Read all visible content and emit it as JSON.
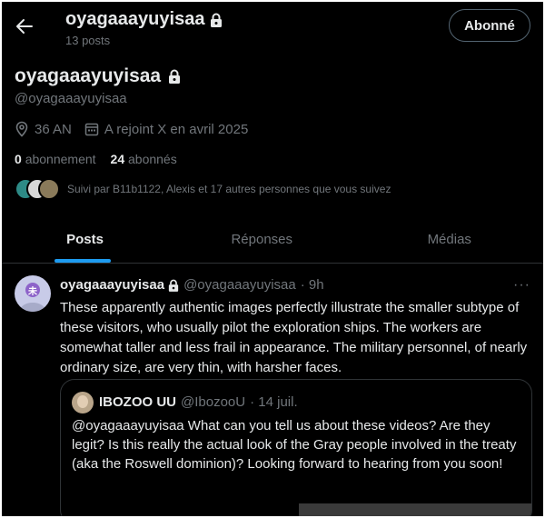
{
  "header": {
    "name": "oyagaaayuyisaa",
    "post_count": "13 posts",
    "follow_label": "Abonné"
  },
  "profile": {
    "name": "oyagaaayuyisaa",
    "handle": "@oyagaaayuyisaa",
    "location": "36 AN",
    "joined": "A rejoint X en avril 2025",
    "following_count": "0",
    "following_label": "abonnement",
    "followers_count": "24",
    "followers_label": "abonnés",
    "followed_by": "Suivi par B11b1122, Alexis et 17 autres personnes que vous suivez"
  },
  "tabs": [
    {
      "label": "Posts",
      "active": true
    },
    {
      "label": "Réponses",
      "active": false
    },
    {
      "label": "Médias",
      "active": false
    }
  ],
  "tweet": {
    "name": "oyagaaayuyisaa",
    "handle": "@oyagaaayuyisaa",
    "date": "· 9h",
    "more": "···",
    "avatar_glyph": "未",
    "text": "These apparently authentic images perfectly illustrate the smaller subtype of these visitors, who usually pilot the exploration ships. The workers are somewhat taller and less frail in appearance. The military personnel, of nearly ordinary size, are very thin, with harsher faces.",
    "quote": {
      "name": "IBOZOO UU",
      "handle": "@IbozooU",
      "date": "· 14 juil.",
      "text": "@oyagaaayuyisaa What can you tell us about these videos? Are they legit? Is this really the actual look of the Gray people involved in the treaty (aka the Roswell dominion)? Looking forward to hearing from you soon!"
    }
  },
  "colors": {
    "background": "#000000",
    "text": "#e7e9ea",
    "muted": "#71767b",
    "accent": "#1d9bf0",
    "border": "#2f3336"
  },
  "icons": [
    "back-arrow-icon",
    "lock-icon",
    "location-pin-icon",
    "calendar-icon",
    "more-icon"
  ]
}
